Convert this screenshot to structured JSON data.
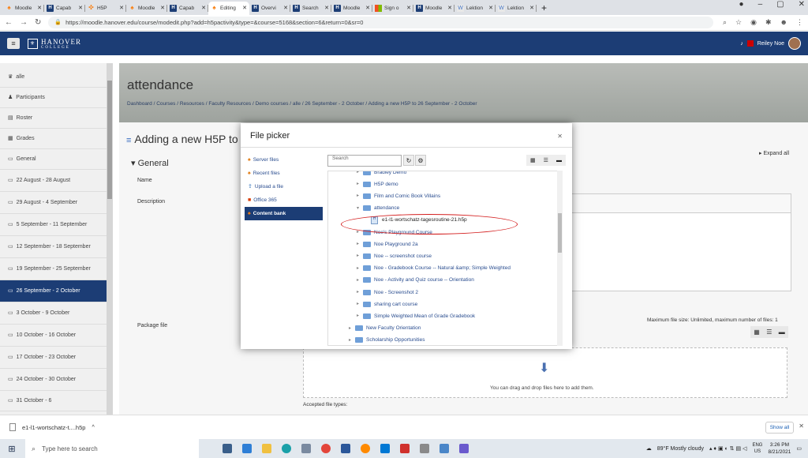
{
  "browser": {
    "tabs": [
      {
        "label": "Moodle",
        "icon": "moodle-icon"
      },
      {
        "label": "Capab",
        "icon": "h5p-icon"
      },
      {
        "label": "H5P",
        "icon": "puzzle-icon"
      },
      {
        "label": "Moodle",
        "icon": "moodle-icon"
      },
      {
        "label": "Capab",
        "icon": "h5p-icon"
      },
      {
        "label": "Editing",
        "icon": "moodle-icon",
        "active": true
      },
      {
        "label": "Overvi",
        "icon": "h5p-icon"
      },
      {
        "label": "Search",
        "icon": "h5p-icon"
      },
      {
        "label": "Moodle",
        "icon": "h5p-icon"
      },
      {
        "label": "Sign o",
        "icon": "microsoft-icon"
      },
      {
        "label": "Moodle",
        "icon": "h5p-icon"
      },
      {
        "label": "Lektion",
        "icon": "lektion-icon"
      },
      {
        "label": "Lektion",
        "icon": "lektion-icon"
      }
    ],
    "url": "https://moodle.hanover.edu/course/modedit.php?add=h5pactivity&type=&course=5168&section=6&return=0&sr=0"
  },
  "moodle": {
    "logo": "HANOVER",
    "logo_sub": "COLLEGE",
    "user_name": "Reiley Noe",
    "sidebar": [
      {
        "label": "alle",
        "icon": "graduation-cap-icon"
      },
      {
        "label": "Participants",
        "icon": "users-icon"
      },
      {
        "label": "Roster",
        "icon": "roster-icon"
      },
      {
        "label": "Grades",
        "icon": "grades-icon"
      },
      {
        "label": "General",
        "icon": "folder-icon"
      },
      {
        "label": "22 August - 28 August",
        "icon": "folder-icon"
      },
      {
        "label": "29 August - 4 September",
        "icon": "folder-icon"
      },
      {
        "label": "5 September - 11 September",
        "icon": "folder-icon"
      },
      {
        "label": "12 September - 18 September",
        "icon": "folder-icon"
      },
      {
        "label": "19 September - 25 September",
        "icon": "folder-icon"
      },
      {
        "label": "26 September - 2 October",
        "icon": "folder-icon",
        "active": true
      },
      {
        "label": "3 October - 9 October",
        "icon": "folder-icon"
      },
      {
        "label": "10 October - 16 October",
        "icon": "folder-icon"
      },
      {
        "label": "17 October - 23 October",
        "icon": "folder-icon"
      },
      {
        "label": "24 October - 30 October",
        "icon": "folder-icon"
      },
      {
        "label": "31 October - 6",
        "icon": "folder-icon"
      }
    ],
    "header_title": "attendance",
    "breadcrumb": "Dashboard / Courses / Resources / Faculty Resources / Demo courses / alle / 26 September - 2 October / Adding a new H5P to 26 September - 2 October",
    "page_title": "Adding a new H5P to",
    "expand_all": "Expand all",
    "section_general": "General",
    "label_name": "Name",
    "label_description": "Description",
    "label_package": "Package file",
    "max_file_size": "Maximum file size: Unlimited, maximum number of files: 1",
    "drop_text": "You can drag and drop files here to add them.",
    "accepted_types": "Accepted file types:"
  },
  "file_picker": {
    "title": "File picker",
    "repositories": [
      {
        "label": "Server files",
        "icon": "server-icon"
      },
      {
        "label": "Recent files",
        "icon": "recent-icon"
      },
      {
        "label": "Upload a file",
        "icon": "upload-icon"
      },
      {
        "label": "Office 365",
        "icon": "office-icon"
      },
      {
        "label": "Content bank",
        "icon": "content-bank-icon",
        "selected": true
      }
    ],
    "search_placeholder": "Search",
    "tree": [
      {
        "label": "Bradley Demo",
        "level": 1,
        "type": "folder"
      },
      {
        "label": "H5P demo",
        "level": 1,
        "type": "folder"
      },
      {
        "label": "Film and Comic Book Villains",
        "level": 1,
        "type": "folder"
      },
      {
        "label": "attendance",
        "level": 1,
        "type": "folder",
        "expanded": true
      },
      {
        "label": "e1-l1-wortschatz-tagesroutine-21.h5p",
        "level": 2,
        "type": "file"
      },
      {
        "label": "Noe's Playground Course",
        "level": 1,
        "type": "folder"
      },
      {
        "label": "Noe Playground 2a",
        "level": 1,
        "type": "folder"
      },
      {
        "label": "Noe -- screenshot course",
        "level": 1,
        "type": "folder"
      },
      {
        "label": "Noe - Gradebook Course -- Natural &amp; Simple Weighted",
        "level": 1,
        "type": "folder"
      },
      {
        "label": "Noe - Activity and Quiz course -- Orientation",
        "level": 1,
        "type": "folder"
      },
      {
        "label": "Noe - Screenshot 2",
        "level": 1,
        "type": "folder"
      },
      {
        "label": "sharing cart course",
        "level": 1,
        "type": "folder"
      },
      {
        "label": "Simple Weighted Mean of Grade Gradebook",
        "level": 1,
        "type": "folder"
      },
      {
        "label": "New Faculty Orientation",
        "level": 0,
        "type": "folder"
      },
      {
        "label": "Scholarship Opportunities",
        "level": 0,
        "type": "folder"
      }
    ]
  },
  "downloads": {
    "file": "e1-l1-wortschatz-t....h5p",
    "show_all": "Show all"
  },
  "taskbar": {
    "search_placeholder": "Type here to search",
    "weather": "89°F Mostly cloudy",
    "lang": "ENG",
    "region": "US",
    "time": "3:26 PM",
    "date": "8/21/2021"
  },
  "colors": {
    "moodle_navy": "#1c3d75",
    "highlight_red": "#d42020"
  }
}
